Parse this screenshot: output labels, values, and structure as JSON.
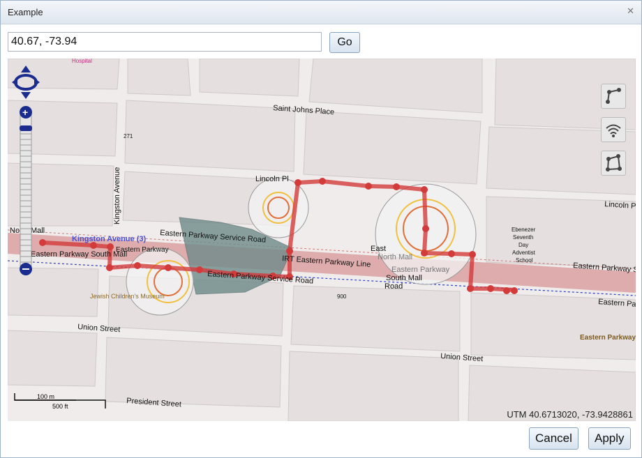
{
  "window": {
    "title": "Example"
  },
  "search": {
    "value": "40.67, -73.94",
    "go_label": "Go"
  },
  "map": {
    "labels": {
      "hospital": "Hospital",
      "saint_johns": "Saint Johns Place",
      "lincoln_pl": "Lincoln Pl",
      "lincoln_place_right": "Lincoln Pl",
      "kingston_ave": "Kingston Avenue",
      "kingston_ave_3": "Kingston Avenue (3)",
      "north_mall": "North Mall",
      "eastern_parkway": "Eastern Parkway",
      "eastern_parkway_south_mall": "Eastern Parkway South Mall",
      "ep_service_road": "Eastern Parkway Service Road",
      "ep_service_road2": "Eastern Parkway Service Road",
      "irt_line": "IRT Eastern Parkway Line",
      "east": "East",
      "north_mall2": "North Mall",
      "eastern_parkway2": "Eastern Parkway",
      "south_mall": "South Mall",
      "road": "Road",
      "eastern_parkway_right": "Eastern Parkway S",
      "eastern_park_right": "Eastern Park",
      "eastern_parkway_brown": "Eastern Parkway",
      "jewish_museum": "Jewish Children's Museum",
      "church": "Ebenezer\nSeventh\nDay\nAdventist\nSchool",
      "union_street": "Union Street",
      "union_street2": "Union Street",
      "president_street": "President Street",
      "num_271": "271",
      "num_900": "900",
      "scale_m": "100 m",
      "scale_ft": "500 ft"
    },
    "coordinates": "UTM 40.6713020, -73.9428861"
  },
  "controls": {
    "draw_line": "draw-line-icon",
    "wifi": "wifi-icon",
    "polygon": "polygon-icon"
  },
  "actions": {
    "cancel": "Cancel",
    "apply": "Apply"
  },
  "colors": {
    "route": "#d33b3b",
    "parkway": "#d98a8a",
    "zoom": "#1b2c8f"
  }
}
